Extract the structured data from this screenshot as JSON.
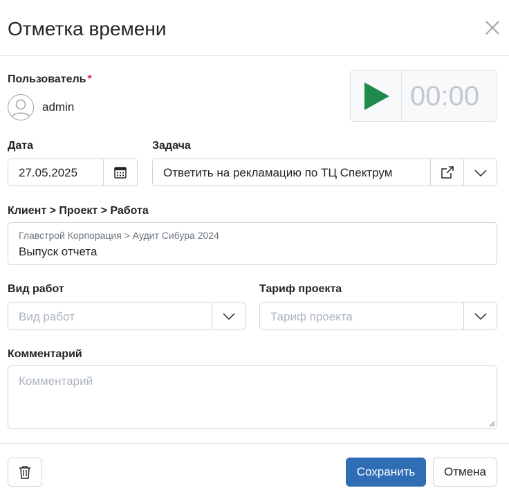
{
  "dialog": {
    "title": "Отметка времени"
  },
  "user": {
    "label": "Пользователь",
    "required_mark": "*",
    "name": "admin"
  },
  "timer": {
    "time": "00:00",
    "play_color": "#1e8a4c"
  },
  "date": {
    "label": "Дата",
    "value": "27.05.2025"
  },
  "task": {
    "label": "Задача",
    "value": "Ответить на рекламацию по ТЦ Спектрум"
  },
  "project": {
    "label": "Клиент > Проект > Работа",
    "breadcrumb": "Главстрой Корпорация > Аудит Сибура 2024",
    "work": "Выпуск отчета"
  },
  "work_type": {
    "label": "Вид работ",
    "placeholder": "Вид работ"
  },
  "tariff": {
    "label": "Тариф проекта",
    "placeholder": "Тариф проекта"
  },
  "comment": {
    "label": "Комментарий",
    "placeholder": "Комментарий"
  },
  "footer": {
    "save_label": "Сохранить",
    "cancel_label": "Отмена",
    "primary_color": "#2f6db5"
  }
}
